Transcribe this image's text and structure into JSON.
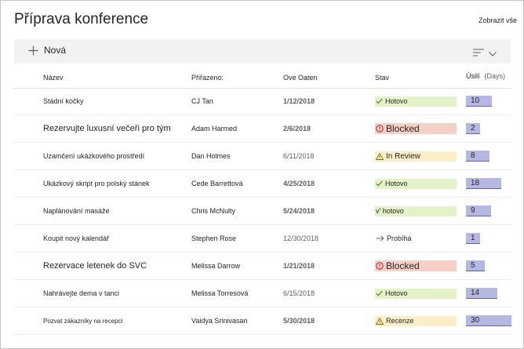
{
  "page": {
    "title": "Příprava konference",
    "show_all": "Zobrazit vše",
    "new_label": "Nová"
  },
  "columns": {
    "name": "Název",
    "assigned": "Přiřazeno:",
    "due": "Ove Oaten",
    "status": "Stav",
    "effort": "Úsilí",
    "effort_unit": "(Days)"
  },
  "icons": {
    "new": "plus-icon",
    "view": "view-lines-icon",
    "view_chevron": "chevron-down-icon"
  },
  "colors": {
    "green_pill": "#e4f2c8",
    "red_pill": "#f6cfc6",
    "yellow_pill": "#fcefc8",
    "effort_bar": "#b4b8e3",
    "effort_bar_line": "#6264a7"
  },
  "effort_max_days": 30,
  "rows": [
    {
      "name": "Stádní kočky",
      "assigned": "CJ Tan",
      "due": "1/12/2018",
      "due_bold": true,
      "status": "Hotovo",
      "status_kind": "green",
      "status_icon": "check-icon",
      "effort": 10
    },
    {
      "name": "Rezervujte luxusní večeři pro tým",
      "assigned": "Adam Harmed",
      "due": "2/6/2018",
      "due_bold": true,
      "status": "Blocked",
      "status_kind": "red",
      "status_icon": "blocked-icon",
      "effort": 2
    },
    {
      "name": "Uzamčení ukázkového prostředí",
      "assigned": "Dan Holmes",
      "due": "6/11/2018",
      "due_bold": false,
      "status": "In Review",
      "status_kind": "yellow",
      "status_icon": "warning-icon",
      "effort": 8
    },
    {
      "name": "Ukázkový skript pro polský stánek",
      "assigned": "Cede Barrettová",
      "due": "4/25/2018",
      "due_bold": true,
      "status": "Hotovo",
      "status_kind": "green",
      "status_icon": "check-icon",
      "effort": 18
    },
    {
      "name": "Naplánování masáže",
      "assigned": "Chris McNulty",
      "due": "5/24/2018",
      "due_bold": true,
      "status": "v' hotovo",
      "status_kind": "green",
      "status_icon": "",
      "effort": 9
    },
    {
      "name": "Koupit nový kalendář",
      "assigned": "Stephen Rose",
      "due": "12/30/2018",
      "due_bold": false,
      "status": "Probíhá",
      "status_kind": "none",
      "status_icon": "arrow-right-icon",
      "effort": 1
    },
    {
      "name": "Rezervace letenek do SVC",
      "assigned": "Melissa Darrow",
      "due": "1/21/2018",
      "due_bold": true,
      "status": "Blocked",
      "status_kind": "red",
      "status_icon": "blocked-icon",
      "effort": 5
    },
    {
      "name": "Nahrávejte dema v tanci",
      "assigned": "Melissa Torresová",
      "due": "6/15/2018",
      "due_bold": false,
      "status": "Hotovo",
      "status_kind": "green",
      "status_icon": "check-icon",
      "effort": 14
    },
    {
      "name": "Pozvat zákazníky na recepci",
      "assigned": "Vaidya Srinivasan",
      "due": "5/30/2018",
      "due_bold": true,
      "status": "Recenze",
      "status_kind": "yellow",
      "status_icon": "warning-icon",
      "effort": 30
    }
  ]
}
